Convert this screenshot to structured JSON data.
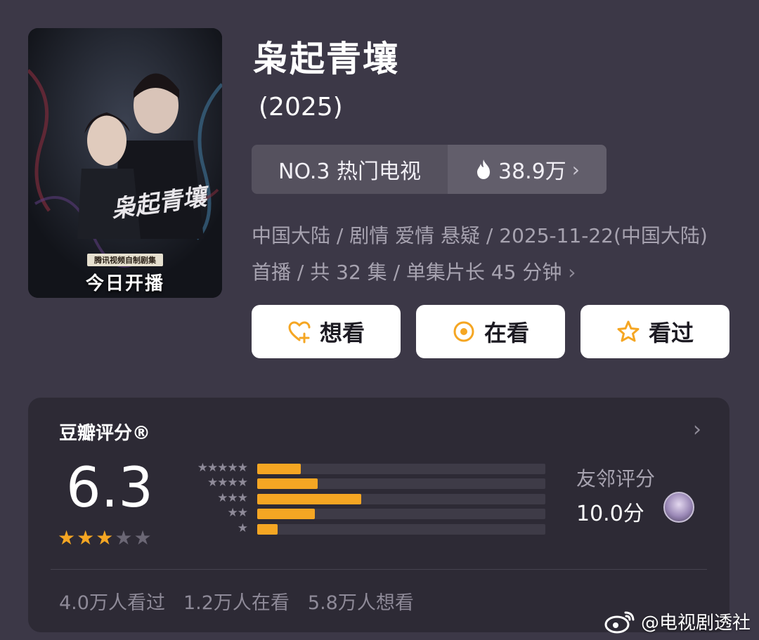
{
  "poster": {
    "calligraphy": "枭起青壤",
    "subtitle": "腾讯视频自制剧集",
    "badge": "今日开播"
  },
  "movie": {
    "title": "枭起青壤",
    "year": "(2025)"
  },
  "ranking": {
    "rank_label": "NO.3 热门电视",
    "heat": "38.9万",
    "heat_icon": "flame-icon"
  },
  "meta": {
    "line": "中国大陆 / 剧情 爱情 悬疑 / 2025-11-22(中国大陆) 首播 / 共 32 集 / 单集片长 45 分钟"
  },
  "actions": {
    "want_label": "想看",
    "watching_label": "在看",
    "watched_label": "看过",
    "accent": "#f5a623"
  },
  "rating": {
    "title": "豆瓣评分®",
    "score": "6.3",
    "stars_filled": 3,
    "stars_total": 5,
    "distribution": [
      {
        "stars": 5,
        "fraction": 0.15
      },
      {
        "stars": 4,
        "fraction": 0.21
      },
      {
        "stars": 3,
        "fraction": 0.36
      },
      {
        "stars": 2,
        "fraction": 0.2
      },
      {
        "stars": 1,
        "fraction": 0.07
      }
    ],
    "friend_label": "友邻评分",
    "friend_score": "10.0分",
    "stats": {
      "watched": "4.0万人看过",
      "watching": "1.2万人在看",
      "want": "5.8万人想看"
    }
  },
  "watermark": {
    "text": "@电视剧透社"
  }
}
